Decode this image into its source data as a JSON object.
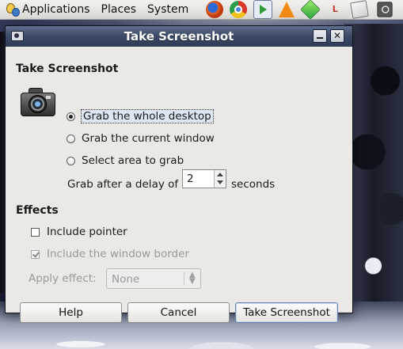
{
  "panel": {
    "menus": [
      "Applications",
      "Places",
      "System"
    ],
    "launchers": [
      "firefox-icon",
      "chrome-icon",
      "media-player-icon",
      "vlc-icon",
      "gem-icon",
      "lyx-icon",
      "notes-icon",
      "screenshot-tool-icon"
    ]
  },
  "window": {
    "title": "Take Screenshot",
    "section_title": "Take Screenshot",
    "options": {
      "whole_desktop": "Grab the whole desktop",
      "current_window": "Grab the current window",
      "select_area": "Select area to grab"
    },
    "selected_option": "whole_desktop",
    "delay_label": "Grab after a delay of",
    "delay_value": "2",
    "delay_units": "seconds",
    "effects_title": "Effects",
    "include_pointer": "Include pointer",
    "include_pointer_checked": false,
    "include_border": "Include the window border",
    "include_border_checked": true,
    "apply_effect_label": "Apply effect:",
    "apply_effect_value": "None",
    "buttons": {
      "help": "Help",
      "cancel": "Cancel",
      "take": "Take Screenshot"
    }
  },
  "colors": {
    "titlebar": "#3e4c69",
    "dialog_bg": "#ebe9e6",
    "panel_bg": "#dcdad5"
  }
}
